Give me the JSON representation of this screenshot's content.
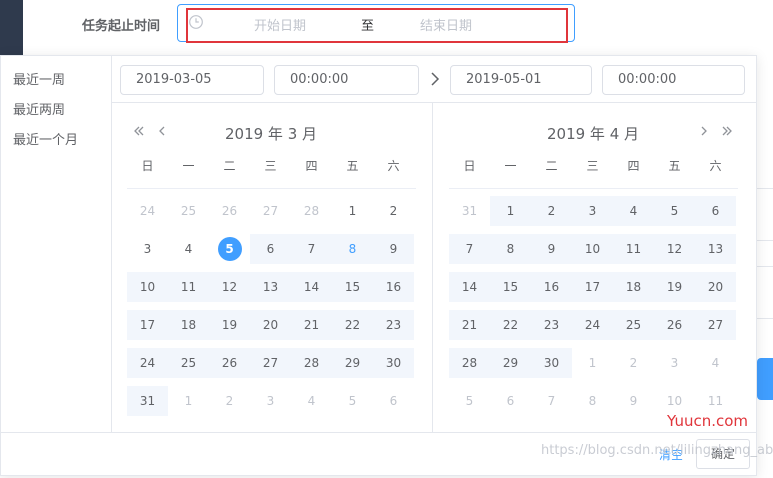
{
  "form": {
    "label": "任务起止时间",
    "start_placeholder": "开始日期",
    "separator": "至",
    "end_placeholder": "结束日期"
  },
  "shortcuts": [
    "最近一周",
    "最近两周",
    "最近一个月"
  ],
  "time_inputs": {
    "start_date": "2019-03-05",
    "start_time": "00:00:00",
    "end_date": "2019-05-01",
    "end_time": "00:00:00"
  },
  "weekdays": [
    "日",
    "一",
    "二",
    "三",
    "四",
    "五",
    "六"
  ],
  "left_month": {
    "title": "2019 年 3 月",
    "rows": [
      [
        "24",
        "25",
        "26",
        "27",
        "28",
        "1",
        "2"
      ],
      [
        "3",
        "4",
        "5",
        "6",
        "7",
        "8",
        "9"
      ],
      [
        "10",
        "11",
        "12",
        "13",
        "14",
        "15",
        "16"
      ],
      [
        "17",
        "18",
        "19",
        "20",
        "21",
        "22",
        "23"
      ],
      [
        "24",
        "25",
        "26",
        "27",
        "28",
        "29",
        "30"
      ],
      [
        "31",
        "1",
        "2",
        "3",
        "4",
        "5",
        "6"
      ]
    ],
    "other_month": [
      [
        0,
        0
      ],
      [
        0,
        1
      ],
      [
        0,
        2
      ],
      [
        0,
        3
      ],
      [
        0,
        4
      ],
      [
        5,
        1
      ],
      [
        5,
        2
      ],
      [
        5,
        3
      ],
      [
        5,
        4
      ],
      [
        5,
        5
      ],
      [
        5,
        6
      ]
    ],
    "selected": [
      1,
      2
    ],
    "today": [
      1,
      5
    ],
    "in_range": [
      [
        1,
        3
      ],
      [
        1,
        4
      ],
      [
        1,
        5
      ],
      [
        1,
        6
      ],
      [
        2,
        0
      ],
      [
        2,
        1
      ],
      [
        2,
        2
      ],
      [
        2,
        3
      ],
      [
        2,
        4
      ],
      [
        2,
        5
      ],
      [
        2,
        6
      ],
      [
        3,
        0
      ],
      [
        3,
        1
      ],
      [
        3,
        2
      ],
      [
        3,
        3
      ],
      [
        3,
        4
      ],
      [
        3,
        5
      ],
      [
        3,
        6
      ],
      [
        4,
        0
      ],
      [
        4,
        1
      ],
      [
        4,
        2
      ],
      [
        4,
        3
      ],
      [
        4,
        4
      ],
      [
        4,
        5
      ],
      [
        4,
        6
      ],
      [
        5,
        0
      ]
    ]
  },
  "right_month": {
    "title": "2019 年 4 月",
    "rows": [
      [
        "31",
        "1",
        "2",
        "3",
        "4",
        "5",
        "6"
      ],
      [
        "7",
        "8",
        "9",
        "10",
        "11",
        "12",
        "13"
      ],
      [
        "14",
        "15",
        "16",
        "17",
        "18",
        "19",
        "20"
      ],
      [
        "21",
        "22",
        "23",
        "24",
        "25",
        "26",
        "27"
      ],
      [
        "28",
        "29",
        "30",
        "1",
        "2",
        "3",
        "4"
      ],
      [
        "5",
        "6",
        "7",
        "8",
        "9",
        "10",
        "11"
      ]
    ],
    "other_month": [
      [
        0,
        0
      ],
      [
        4,
        3
      ],
      [
        4,
        4
      ],
      [
        4,
        5
      ],
      [
        4,
        6
      ],
      [
        5,
        0
      ],
      [
        5,
        1
      ],
      [
        5,
        2
      ],
      [
        5,
        3
      ],
      [
        5,
        4
      ],
      [
        5,
        5
      ],
      [
        5,
        6
      ]
    ],
    "in_range": [
      [
        0,
        1
      ],
      [
        0,
        2
      ],
      [
        0,
        3
      ],
      [
        0,
        4
      ],
      [
        0,
        5
      ],
      [
        0,
        6
      ],
      [
        1,
        0
      ],
      [
        1,
        1
      ],
      [
        1,
        2
      ],
      [
        1,
        3
      ],
      [
        1,
        4
      ],
      [
        1,
        5
      ],
      [
        1,
        6
      ],
      [
        2,
        0
      ],
      [
        2,
        1
      ],
      [
        2,
        2
      ],
      [
        2,
        3
      ],
      [
        2,
        4
      ],
      [
        2,
        5
      ],
      [
        2,
        6
      ],
      [
        3,
        0
      ],
      [
        3,
        1
      ],
      [
        3,
        2
      ],
      [
        3,
        3
      ],
      [
        3,
        4
      ],
      [
        3,
        5
      ],
      [
        3,
        6
      ],
      [
        4,
        0
      ],
      [
        4,
        1
      ],
      [
        4,
        2
      ]
    ]
  },
  "footer": {
    "clear": "清空",
    "confirm": "确定"
  },
  "watermarks": {
    "brand": "Yuucn.com",
    "url": "https://blog.csdn.net/lilingzhang_abc"
  },
  "colors": {
    "accent": "#409eff",
    "range_bg": "#f2f6fc",
    "annotation_red": "#e0353b"
  }
}
